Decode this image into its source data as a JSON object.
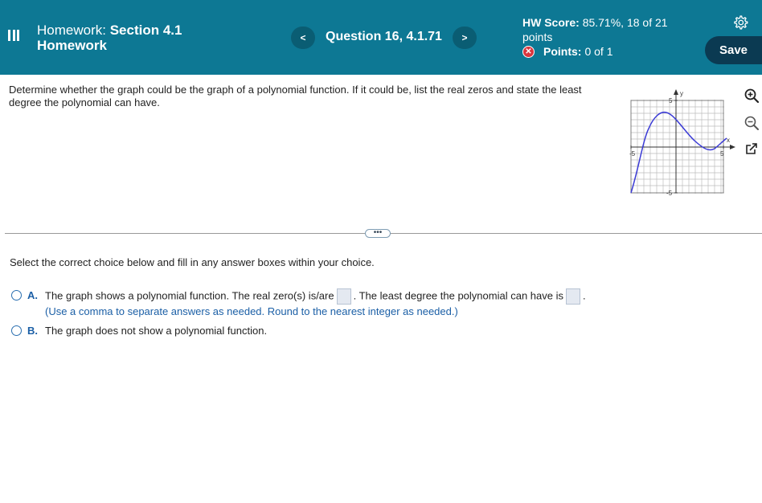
{
  "header": {
    "title_prefix": "Homework:",
    "title_section": "Section 4.1",
    "title_rest": "Homework",
    "prev_label": "<",
    "question_label": "Question 16, 4.1.71",
    "next_label": ">",
    "score_label": "HW Score:",
    "score_value": "85.71%, 18 of 21",
    "score_unit": "points",
    "points_label": "Points:",
    "points_value": "0 of 1",
    "save_label": "Save"
  },
  "question": {
    "prompt": "Determine whether the graph could be the graph of a polynomial function. If it could be, list the real zeros and state the least degree the polynomial can have.",
    "graph": {
      "x_label": "x",
      "y_label": "y",
      "tick_pos": "5",
      "tick_neg": "-5",
      "y_tick_pos": "5",
      "y_tick_neg": "-5",
      "curve_color": "#3b3bd6"
    },
    "more_label": "•••"
  },
  "answer": {
    "instruction": "Select the correct choice below and fill in any answer boxes within your choice.",
    "choice_a": {
      "letter": "A.",
      "text_1": "The graph shows a polynomial function. The real zero(s) is/are",
      "text_2": ". The least degree the polynomial can have is",
      "text_3": ".",
      "hint": "(Use a comma to separate answers as needed.  Round to the nearest integer as needed.)"
    },
    "choice_b": {
      "letter": "B.",
      "text": "The graph does not show a polynomial function."
    }
  },
  "colors": {
    "header_bg": "#0d7894",
    "save_bg": "#0b3a52",
    "accent_blue": "#1b5fa6",
    "error_red": "#d9363e"
  }
}
